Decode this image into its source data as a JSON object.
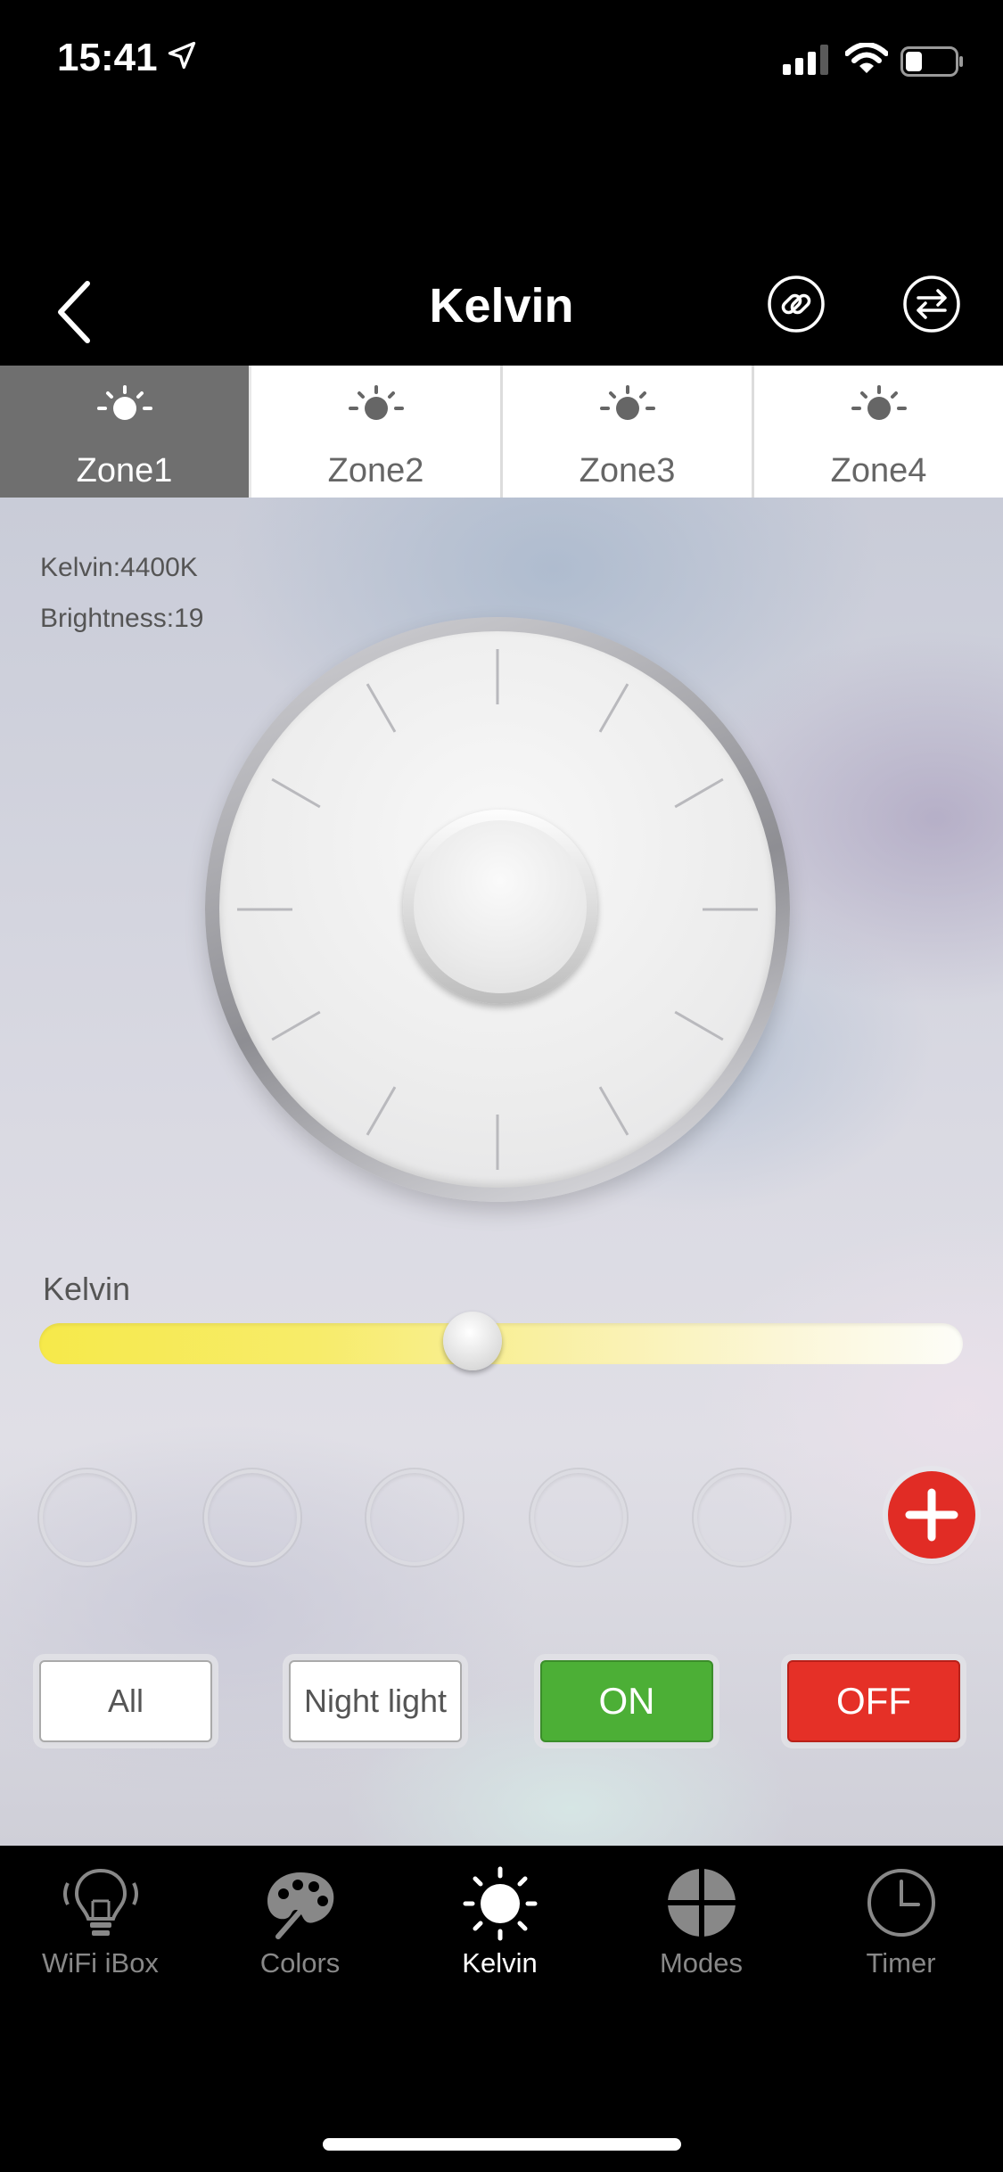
{
  "status_bar": {
    "time": "15:41"
  },
  "navbar": {
    "title": "Kelvin"
  },
  "zones": [
    {
      "label": "Zone1",
      "active": true
    },
    {
      "label": "Zone2",
      "active": false
    },
    {
      "label": "Zone3",
      "active": false
    },
    {
      "label": "Zone4",
      "active": false
    }
  ],
  "readout": {
    "kelvin": "Kelvin:4400K",
    "brightness": "Brightness:19"
  },
  "kelvin_slider": {
    "label": "Kelvin",
    "position_fraction": 0.47
  },
  "preset_slots_count": 5,
  "buttons": {
    "all": "All",
    "night_light": "Night light",
    "on": "ON",
    "off": "OFF"
  },
  "tabbar": {
    "items": [
      {
        "label": "WiFi iBox",
        "icon": "bulb-icon",
        "active": false
      },
      {
        "label": "Colors",
        "icon": "palette-icon",
        "active": false
      },
      {
        "label": "Kelvin",
        "icon": "sun-icon",
        "active": true
      },
      {
        "label": "Modes",
        "icon": "modes-icon",
        "active": false
      },
      {
        "label": "Timer",
        "icon": "clock-icon",
        "active": false
      }
    ]
  },
  "colors": {
    "on_green": "#4caf36",
    "off_red": "#e53027",
    "add_red": "#e12c25",
    "active_zone": "#6f6f6f"
  }
}
